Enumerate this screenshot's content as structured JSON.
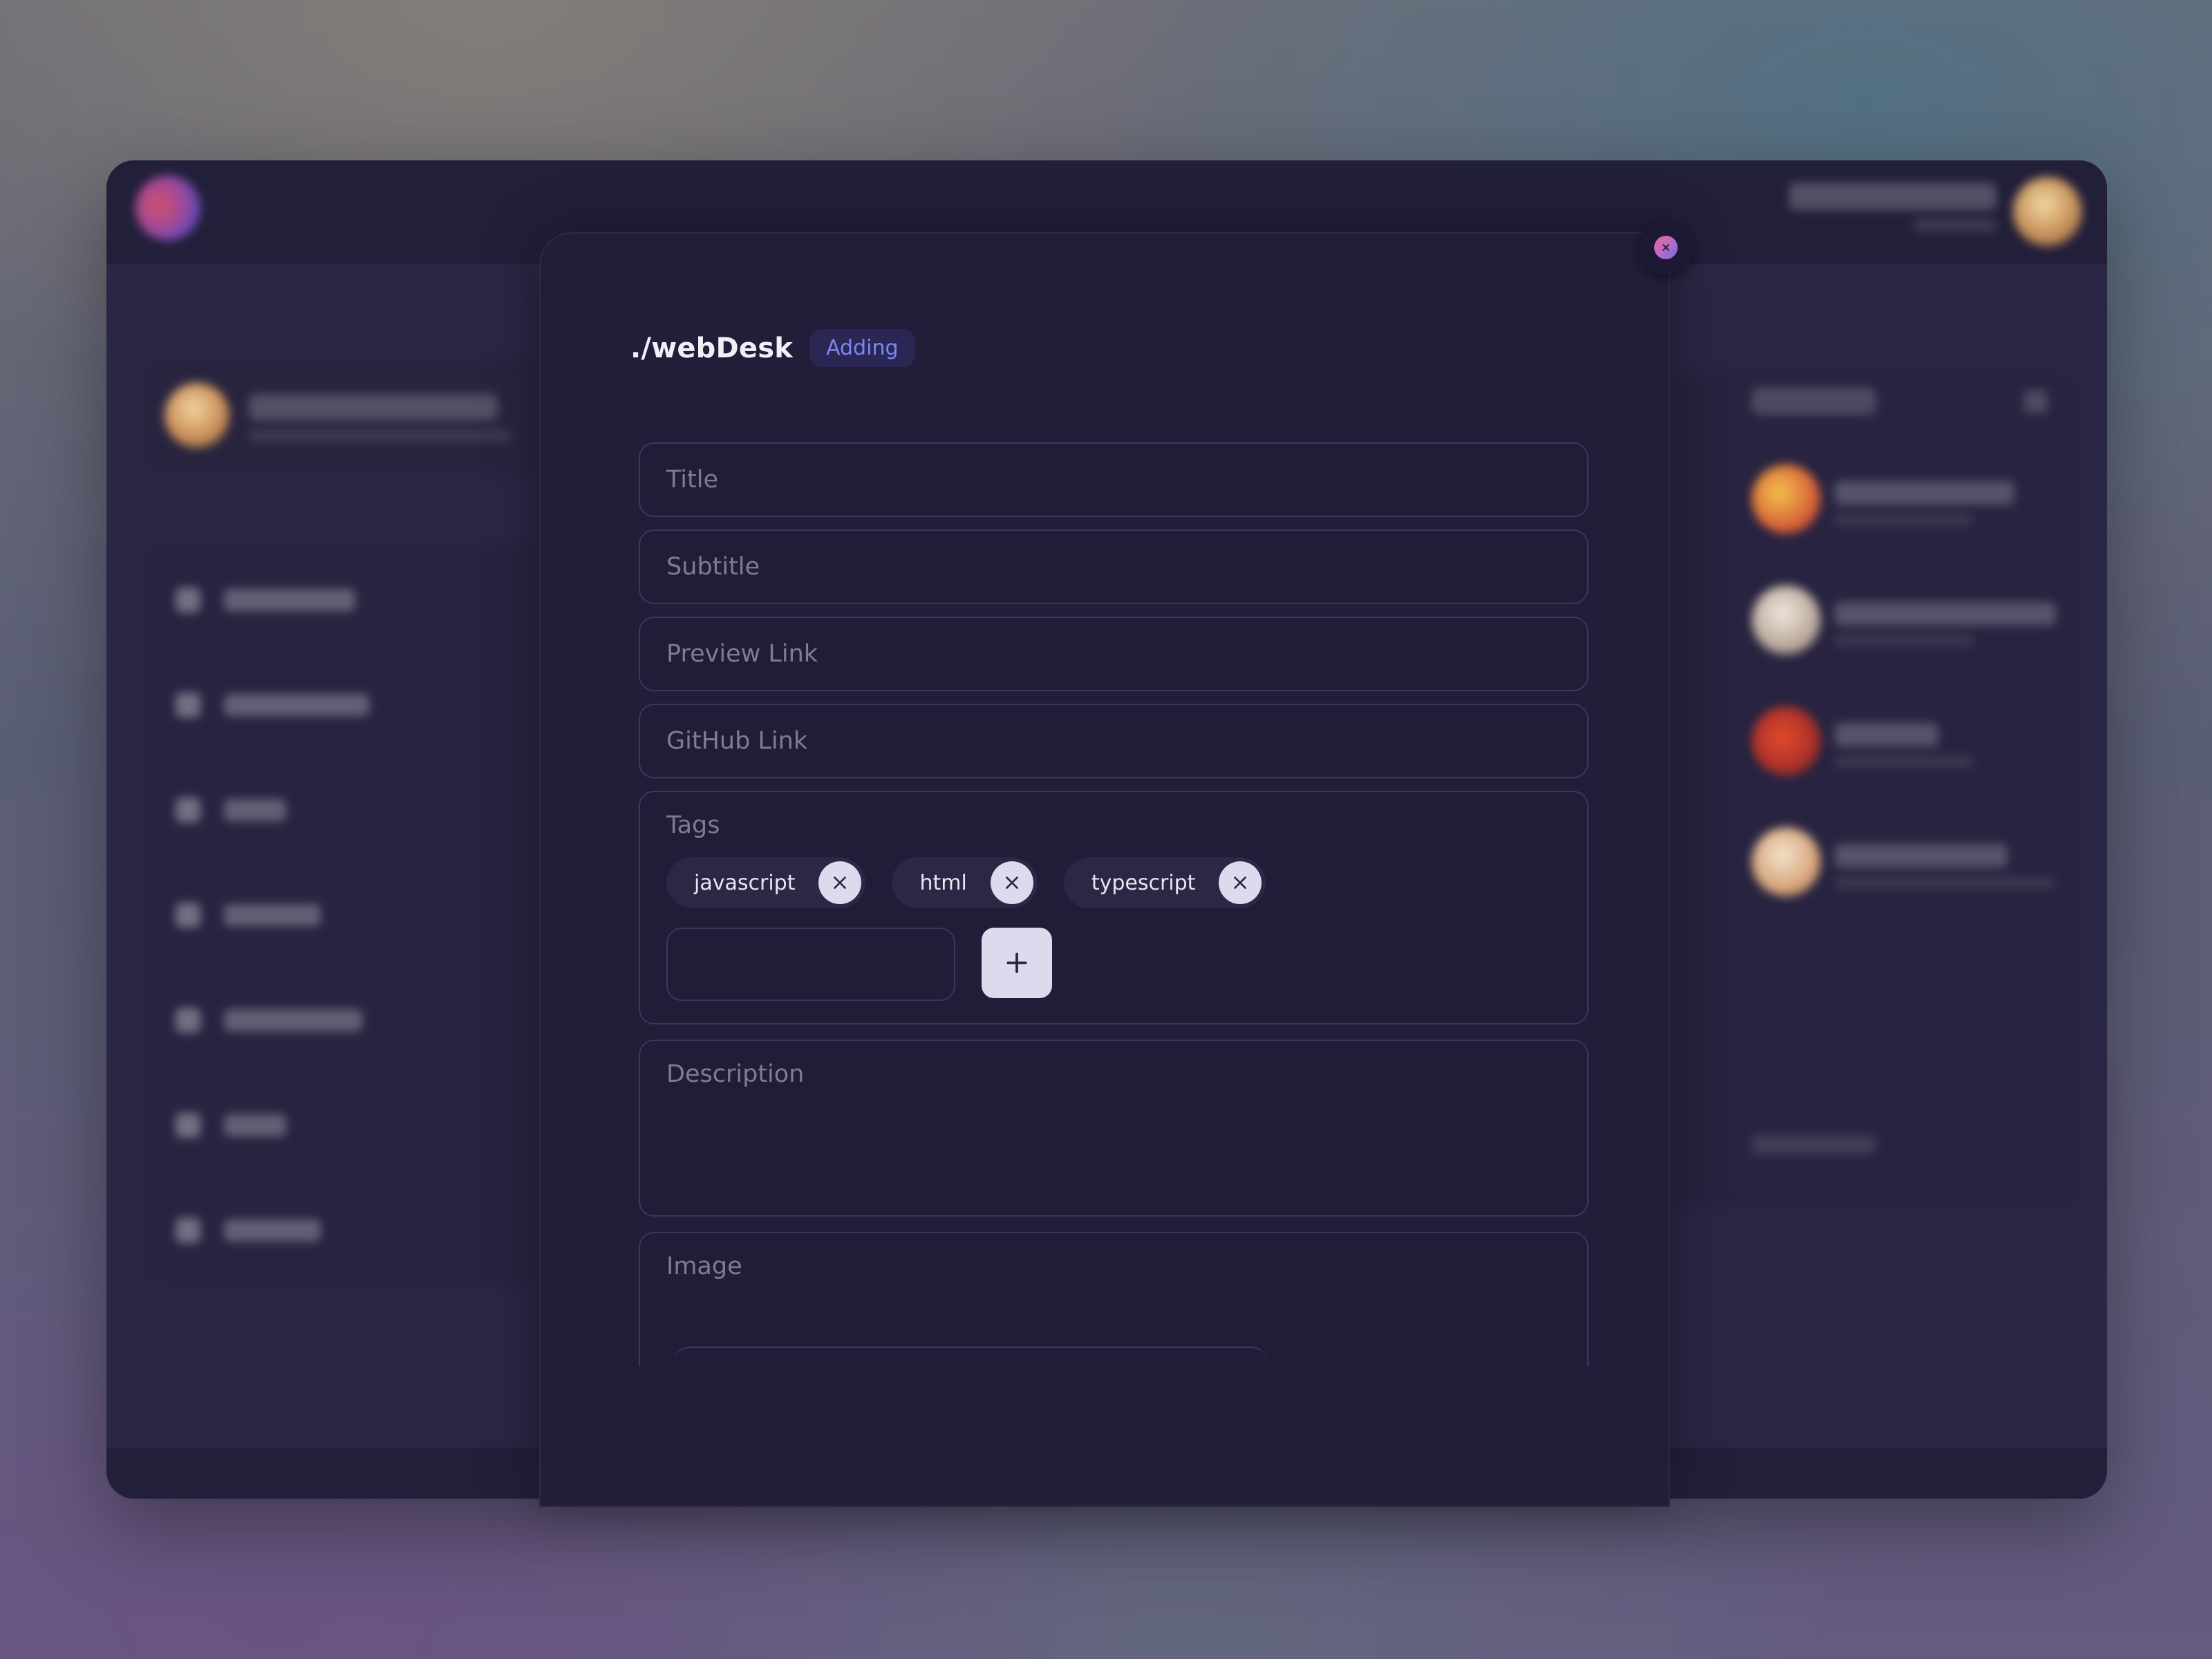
{
  "modal": {
    "brand": "./webDesk",
    "mode_badge": "Adding",
    "close_icon": "close-icon"
  },
  "form": {
    "title": {
      "placeholder": "Title",
      "value": ""
    },
    "subtitle": {
      "placeholder": "Subtitle",
      "value": ""
    },
    "preview_link": {
      "placeholder": "Preview Link",
      "value": ""
    },
    "github_link": {
      "placeholder": "GitHub Link",
      "value": ""
    },
    "tags": {
      "label": "Tags",
      "items": [
        "javascript",
        "html",
        "typescript"
      ],
      "new_tag_value": "",
      "add_icon": "plus-icon",
      "remove_icon": "x-icon"
    },
    "description": {
      "label": "Description",
      "value": ""
    },
    "image": {
      "label": "Image"
    }
  },
  "colors": {
    "modal_bg": "#221d38",
    "field_border": "#3c3859",
    "badge_text": "#7d86f2",
    "badge_bg": "#2b2755",
    "chip_button": "#dcdbed"
  }
}
